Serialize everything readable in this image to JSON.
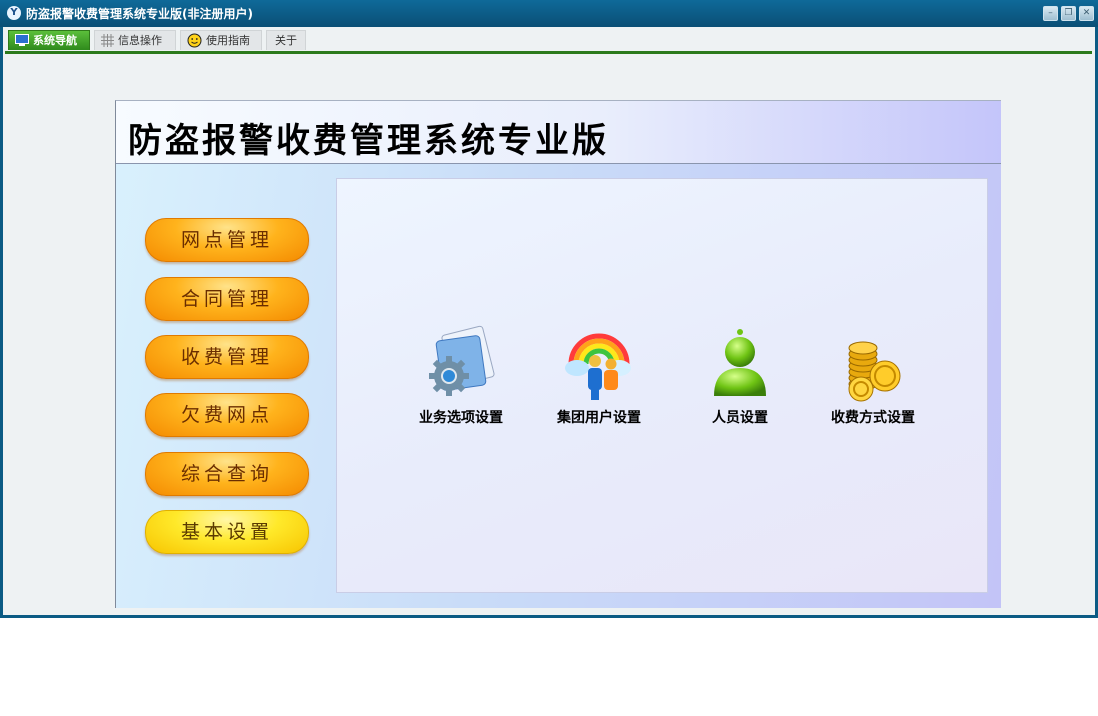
{
  "window": {
    "title": "防盗报警收费管理系统专业版(非注册用户)",
    "app_icon": "Y"
  },
  "window_controls": [
    "minimize-icon",
    "restore-icon",
    "close-icon"
  ],
  "tabs": [
    {
      "label": "系统导航",
      "icon": "monitor-icon",
      "active": true
    },
    {
      "label": "信息操作",
      "icon": "grid-icon",
      "active": false
    },
    {
      "label": "使用指南",
      "icon": "smiley-icon",
      "active": false
    },
    {
      "label": "关于",
      "icon": "",
      "active": false
    }
  ],
  "main": {
    "title": "防盗报警收费管理系统专业版",
    "nav_buttons": [
      {
        "label": "网点管理",
        "selected": false
      },
      {
        "label": "合同管理",
        "selected": false
      },
      {
        "label": "收费管理",
        "selected": false
      },
      {
        "label": "欠费网点",
        "selected": false
      },
      {
        "label": "综合查询",
        "selected": false
      },
      {
        "label": "基本设置",
        "selected": true
      }
    ],
    "tools": [
      {
        "label": "业务选项设置",
        "icon": "gear-document-icon"
      },
      {
        "label": "集团用户设置",
        "icon": "rainbow-group-icon"
      },
      {
        "label": "人员设置",
        "icon": "user-icon"
      },
      {
        "label": "收费方式设置",
        "icon": "coins-icon"
      }
    ]
  },
  "colors": {
    "titlebar": "#0b5b84",
    "active_tab": "#3a9a22",
    "nav_button": "#f9a10f",
    "nav_selected": "#f7d800"
  }
}
